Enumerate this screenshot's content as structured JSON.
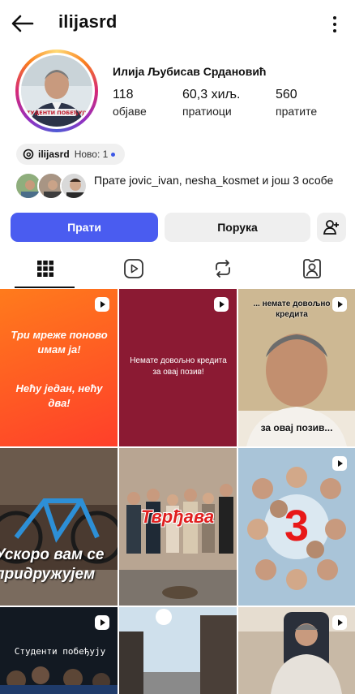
{
  "header": {
    "username": "ilijasrd",
    "back_icon": "arrow-left-icon",
    "menu_icon": "more-vertical-icon"
  },
  "profile": {
    "full_name": "Илија Љубисав Срдановић",
    "avatar_caption": "СТУДЕНТИ ПОБЕЂУЈУ!",
    "stats": [
      {
        "value": "118",
        "label": "објаве"
      },
      {
        "value": "60,3 хиљ.",
        "label": "пратиоци"
      },
      {
        "value": "560",
        "label": "пратите"
      }
    ]
  },
  "threads": {
    "handle": "ilijasrd",
    "badge": "Ново: 1"
  },
  "followed_by": {
    "prefix": "Прате ",
    "names": "jovic_ivan, nesha_kosmet",
    "suffix": " и још 3 особе"
  },
  "actions": {
    "follow": "Прати",
    "message": "Порука",
    "add_user_icon": "add-user-icon"
  },
  "tabs": [
    "grid-icon",
    "reels-icon",
    "reposts-icon",
    "tagged-icon"
  ],
  "posts": [
    {
      "text1": "Три мреже поново имам ја!",
      "text2": "Нећу један, нећу два!"
    },
    {
      "text": "Немате довољно кредита за овај позив!"
    },
    {
      "top": "... немате довољно кредита",
      "bottom": "за овај позив..."
    },
    {
      "text": "Ускоро вам се придружујем"
    },
    {
      "text": "Тврђава"
    },
    {
      "text": "3"
    },
    {
      "text": "Студенти побеђују"
    },
    {
      "text": ""
    },
    {
      "text": ""
    }
  ],
  "colors": {
    "accent": "#4a5cf0",
    "maroon": "#8b1a33",
    "orange_top": "#ff6a1a",
    "orange_bottom": "#ff4a1f"
  }
}
